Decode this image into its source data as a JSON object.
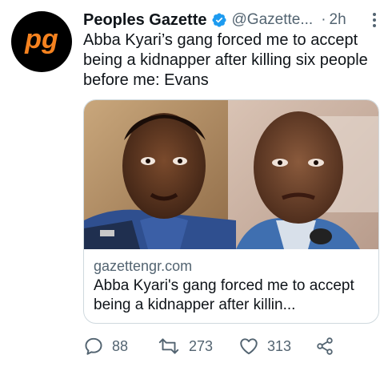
{
  "tweet": {
    "author": {
      "display_name": "Peoples Gazette",
      "handle": "@Gazette...",
      "verified": true,
      "avatar_icon": "pg-logo-icon",
      "avatar_text": "pg",
      "avatar_color": "#f5821f"
    },
    "separator": "·",
    "time": "2h",
    "text": "Abba Kyari’s gang forced me to accept being a kidnapper after killing six people before me: Evans",
    "card": {
      "domain": "gazettengr.com",
      "title": "Abba Kyari's gang forced me to accept being a kidnapper after killin..."
    },
    "actions": {
      "reply_count": "88",
      "retweet_count": "273",
      "like_count": "313"
    }
  },
  "colors": {
    "verified_blue": "#1d9bf0",
    "secondary_text": "#536471",
    "brand_orange": "#f5821f"
  }
}
